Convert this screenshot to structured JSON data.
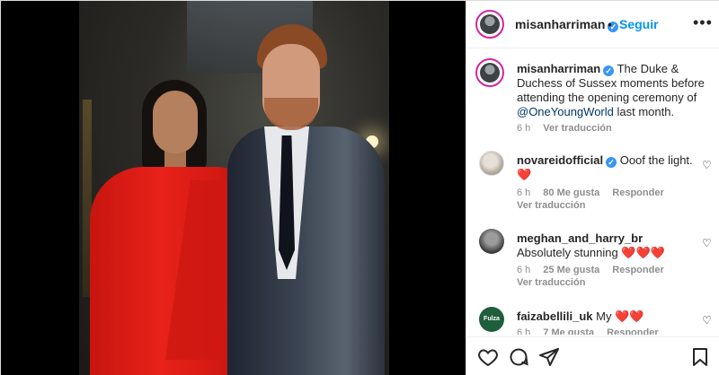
{
  "header": {
    "username": "misanharriman",
    "separator": "•",
    "follow_label": "Seguir",
    "more_label": "•••"
  },
  "caption": {
    "username": "misanharriman",
    "text_before": "The Duke & Duchess of Sussex moments before attending the opening ceremony of ",
    "mention": "@OneYoungWorld",
    "text_after": " last month.",
    "time": "6 h",
    "translate_label": "Ver traducción"
  },
  "comments": [
    {
      "username": "novareidofficial",
      "verified": true,
      "text": "Ooof the light.",
      "emoji": "❤️",
      "time": "6 h",
      "likes": "80 Me gusta",
      "reply_label": "Responder",
      "translate_label": "Ver traducción"
    },
    {
      "username": "meghan_and_harry_br",
      "verified": false,
      "text": "Absolutely stunning",
      "emoji": "❤️❤️❤️",
      "time": "6 h",
      "likes": "25 Me gusta",
      "reply_label": "Responder",
      "translate_label": "Ver traducción"
    },
    {
      "username": "faizabellili_uk",
      "verified": false,
      "text": "My",
      "emoji": "❤️❤️",
      "avatar_text": "Fulza",
      "time": "6 h",
      "likes": "7 Me gusta",
      "reply_label": "Responder"
    }
  ],
  "actions": {
    "icons": [
      "heart-icon",
      "comment-icon",
      "share-icon",
      "bookmark-icon"
    ]
  },
  "colors": {
    "link_blue": "#0095f6",
    "mention_blue": "#00376b",
    "verified_blue": "#3897f0",
    "heart_red": "#ed4956",
    "muted": "#8e8e8e"
  }
}
